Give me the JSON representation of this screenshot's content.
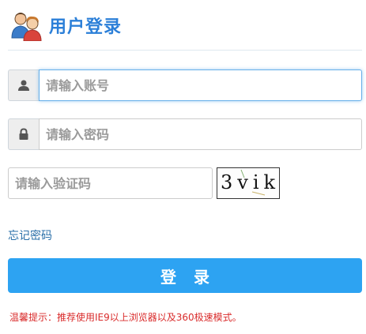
{
  "header": {
    "title": "用户登录",
    "icon": "users-icon"
  },
  "form": {
    "username": {
      "placeholder": "请输入账号",
      "value": "",
      "icon": "user-icon"
    },
    "password": {
      "placeholder": "请输入密码",
      "value": "",
      "icon": "lock-icon"
    },
    "captcha": {
      "placeholder": "请输入验证码",
      "value": "",
      "image_text": "3vik"
    },
    "forgot_label": "忘记密码",
    "login_label": "登录"
  },
  "tip": "温馨提示：推荐使用IE9以上浏览器以及360极速模式。",
  "colors": {
    "accent": "#2da3f2",
    "title": "#2b7fd8",
    "tip": "#d92b2b",
    "link": "#2a6fa8"
  }
}
